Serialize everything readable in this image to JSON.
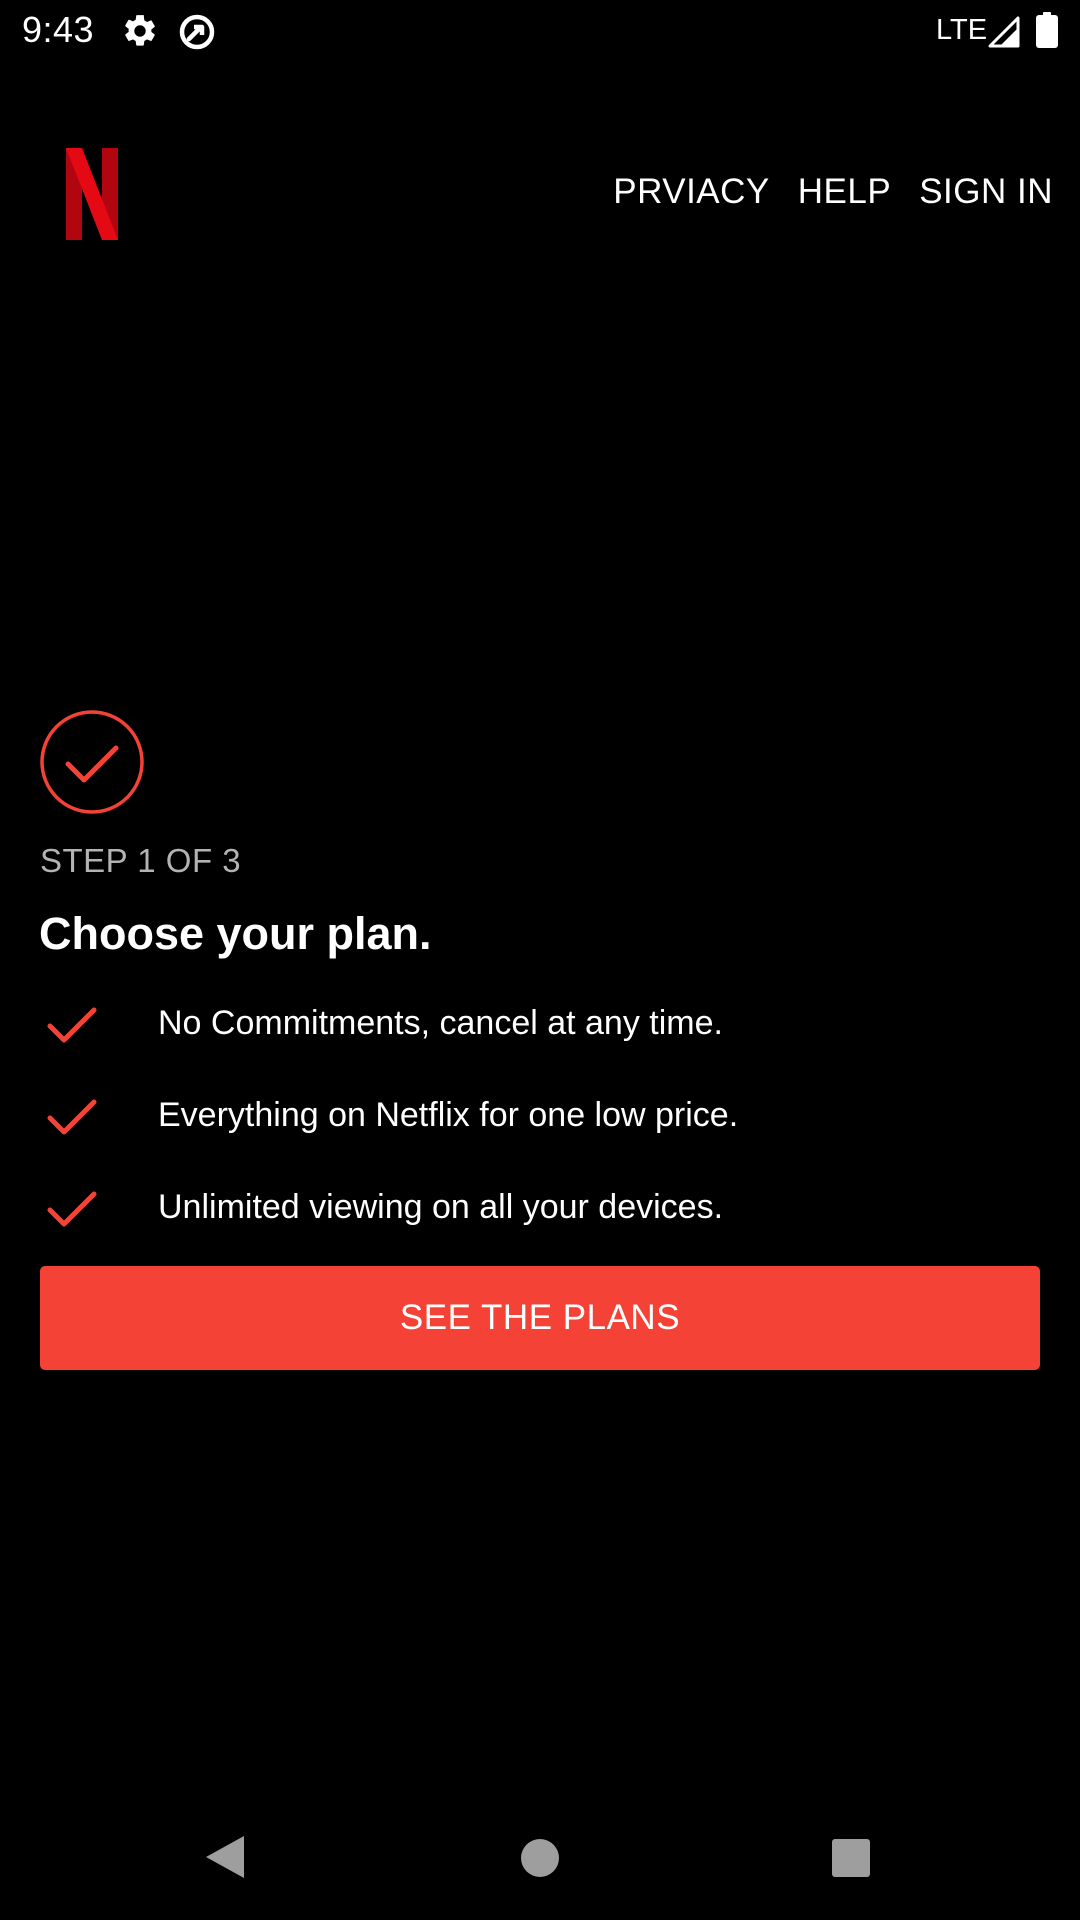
{
  "status_bar": {
    "time": "9:43",
    "network": "LTE",
    "icons": [
      "gear-icon",
      "sync-icon",
      "signal-icon",
      "battery-icon"
    ]
  },
  "header": {
    "logo": "netflix-logo",
    "nav": {
      "privacy": "PRVIACY",
      "help": "HELP",
      "sign_in": "SIGN IN"
    }
  },
  "main": {
    "step": "STEP 1 OF 3",
    "title": "Choose your plan.",
    "benefits": [
      "No Commitments, cancel at any time.",
      "Everything on Netflix for one low price.",
      "Unlimited viewing on all your devices."
    ],
    "cta_label": "SEE THE PLANS"
  },
  "colors": {
    "background": "#000000",
    "accent": "#f44336",
    "brand_red": "#e50914",
    "muted_text": "#b3b3b3"
  },
  "system_nav": [
    "back-icon",
    "home-icon",
    "recents-icon"
  ]
}
